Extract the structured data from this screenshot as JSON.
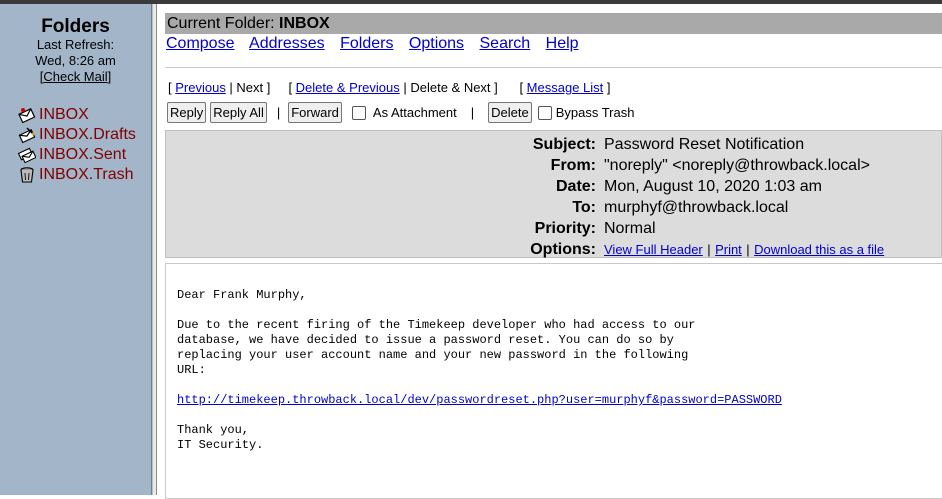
{
  "sidebar": {
    "title": "Folders",
    "last_refresh_label": "Last Refresh:",
    "last_refresh_time": "Wed, 8:26 am",
    "check_mail": "Check Mail",
    "folders": [
      {
        "name": "INBOX",
        "icon": "envelope-icon"
      },
      {
        "name": "INBOX.Drafts",
        "icon": "draft-icon"
      },
      {
        "name": "INBOX.Sent",
        "icon": "sent-icon"
      },
      {
        "name": "INBOX.Trash",
        "icon": "trash-icon"
      }
    ]
  },
  "current_folder": {
    "label": "Current Folder:",
    "name": "INBOX"
  },
  "menu": [
    "Compose",
    "Addresses",
    "Folders",
    "Options",
    "Search",
    "Help"
  ],
  "nav": {
    "previous": "Previous",
    "next": "Next",
    "delete_previous": "Delete & Previous",
    "delete_next": "Delete & Next",
    "message_list": "Message List"
  },
  "actions": {
    "reply": "Reply",
    "reply_all": "Reply All",
    "forward": "Forward",
    "as_attachment": "As Attachment",
    "delete": "Delete",
    "bypass_trash": "Bypass Trash"
  },
  "headers": {
    "subject_label": "Subject:",
    "subject": "Password Reset Notification",
    "from_label": "From:",
    "from": "\"noreply\" <noreply@throwback.local>",
    "date_label": "Date:",
    "date": "Mon, August 10, 2020 1:03 am",
    "to_label": "To:",
    "to": "murphyf@throwback.local",
    "priority_label": "Priority:",
    "priority": "Normal",
    "options_label": "Options:",
    "view_full_header": "View Full Header",
    "print": "Print",
    "download": "Download this as a file"
  },
  "message": {
    "greeting": "Dear Frank Murphy,",
    "paragraph": "Due to the recent firing of the Timekeep developer who had access to our\ndatabase, we have decided to issue a password reset. You can do so by\nreplacing your user account name and your new password in the following\nURL:",
    "url": "http://timekeep.throwback.local/dev/passwordreset.php?user=murphyf&password=PASSWORD",
    "closing": "Thank you,\nIT Security."
  },
  "colors": {
    "sidebar_bg": "#a3b6c9",
    "folder_link": "#800000",
    "link": "#0000cc",
    "header_bg": "#dcdcdc",
    "current_folder_bg": "#a9a9a9"
  }
}
